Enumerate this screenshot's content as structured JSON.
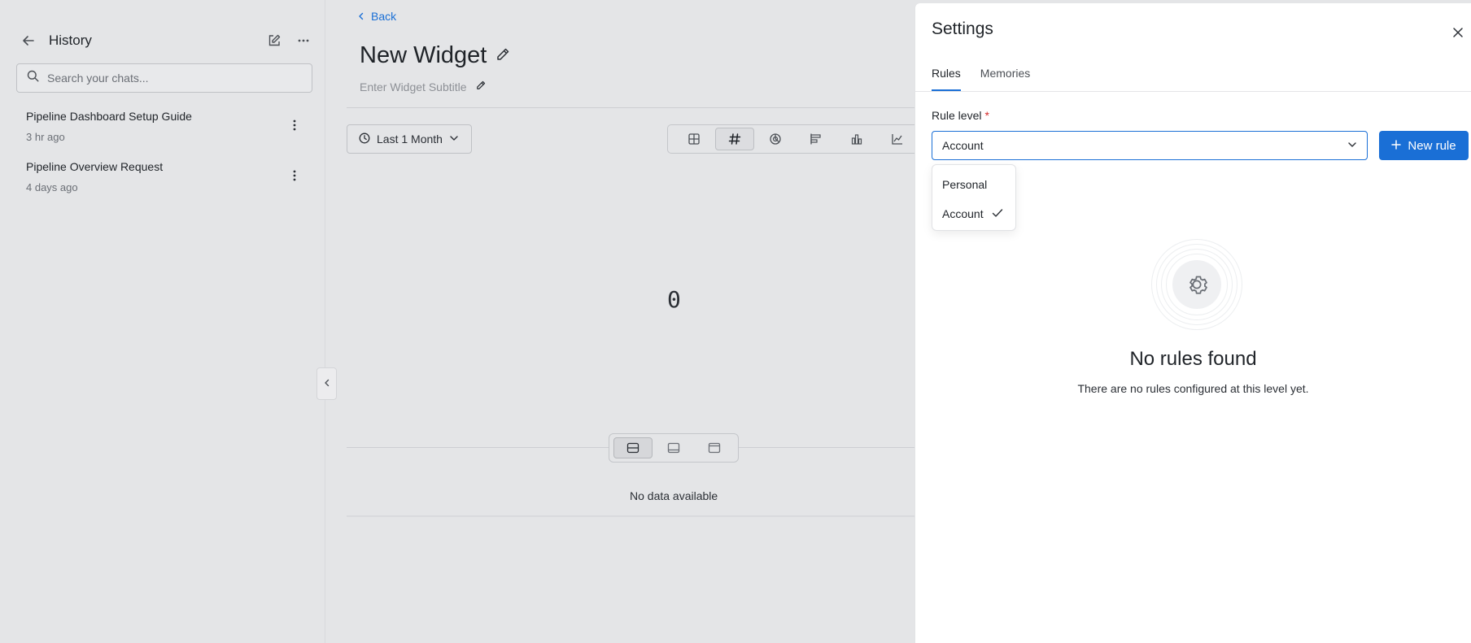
{
  "sidebar": {
    "title": "History",
    "search_placeholder": "Search your chats...",
    "chats": [
      {
        "title": "Pipeline Dashboard Setup Guide",
        "time": "3 hr ago"
      },
      {
        "title": "Pipeline Overview Request",
        "time": "4 days ago"
      }
    ]
  },
  "main": {
    "back_label": "Back",
    "widget_title": "New Widget",
    "widget_subtitle_placeholder": "Enter Widget Subtitle",
    "range_label": "Last 1 Month",
    "viz_icons": [
      "table-icon",
      "number-icon",
      "pie-icon",
      "horizontal-bar-icon",
      "bar-chart-icon",
      "line-chart-icon"
    ],
    "active_viz": "number-icon",
    "value": "0",
    "no_data": "No data available"
  },
  "settings": {
    "title": "Settings",
    "tabs": [
      {
        "label": "Rules"
      },
      {
        "label": "Memories"
      }
    ],
    "rule_level_label": "Rule level",
    "required_mark": "*",
    "selected_level": "Account",
    "new_rule_label": "New rule",
    "options": [
      {
        "label": "Personal"
      },
      {
        "label": "Account"
      }
    ],
    "empty_title": "No rules found",
    "empty_subtitle": "There are no rules configured at this level yet."
  },
  "colors": {
    "accent": "#1a6fd6",
    "required": "#d42a2a",
    "background": "#e4e5e7"
  }
}
